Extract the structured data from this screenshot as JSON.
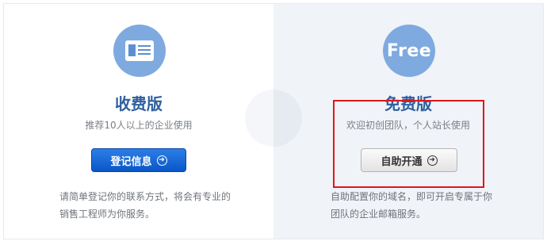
{
  "plans": {
    "paid": {
      "title": "收费版",
      "subtitle": "推荐10人以上的企业使用",
      "button_label": "登记信息",
      "desc_line1": "请简单登记你的联系方式，将会有专业的",
      "desc_line2": "销售工程师为你服务。",
      "icon": "business-card-icon"
    },
    "free": {
      "badge_text": "Free",
      "title": "免费版",
      "subtitle": "欢迎初创团队，个人站长使用",
      "button_label": "自助开通",
      "desc_line1": "自助配置你的域名，即可开启专属于你",
      "desc_line2": "团队的企业邮箱服务。"
    }
  },
  "colors": {
    "accent_blue": "#2f5f9e",
    "icon_bg": "#7faae0",
    "primary_button": "#0a56c8",
    "highlight": "#e0161c"
  }
}
